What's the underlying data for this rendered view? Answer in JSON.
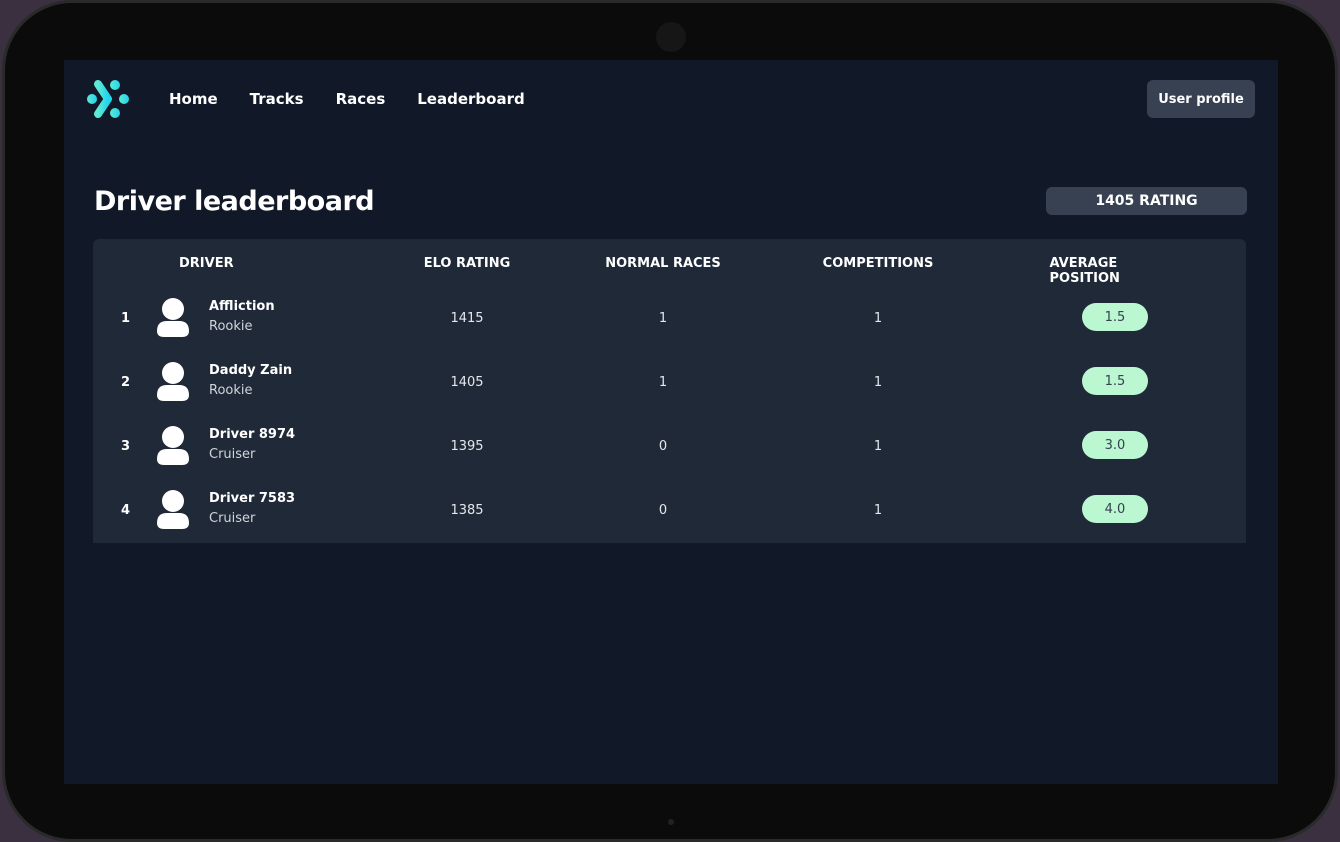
{
  "nav": {
    "items": [
      "Home",
      "Tracks",
      "Races",
      "Leaderboard"
    ],
    "profile_label": "User profile"
  },
  "page": {
    "title": "Driver leaderboard",
    "rating_badge": "1405 RATING"
  },
  "table": {
    "headers": [
      "DRIVER",
      "ELO RATING",
      "NORMAL RACES",
      "COMPETITIONS",
      "AVERAGE POSITION"
    ],
    "rows": [
      {
        "rank": "1",
        "name": "Affliction",
        "tier": "Rookie",
        "elo": "1415",
        "normal": "1",
        "competitions": "1",
        "avg": "1.5"
      },
      {
        "rank": "2",
        "name": "Daddy Zain",
        "tier": "Rookie",
        "elo": "1405",
        "normal": "1",
        "competitions": "1",
        "avg": "1.5"
      },
      {
        "rank": "3",
        "name": "Driver 8974",
        "tier": "Cruiser",
        "elo": "1395",
        "normal": "0",
        "competitions": "1",
        "avg": "3.0"
      },
      {
        "rank": "4",
        "name": "Driver 7583",
        "tier": "Cruiser",
        "elo": "1385",
        "normal": "0",
        "competitions": "1",
        "avg": "4.0"
      }
    ]
  },
  "colors": {
    "accent": "#2dd4e0",
    "pill": "#bbf7d0",
    "background": "#111827",
    "card": "#1f2937"
  }
}
